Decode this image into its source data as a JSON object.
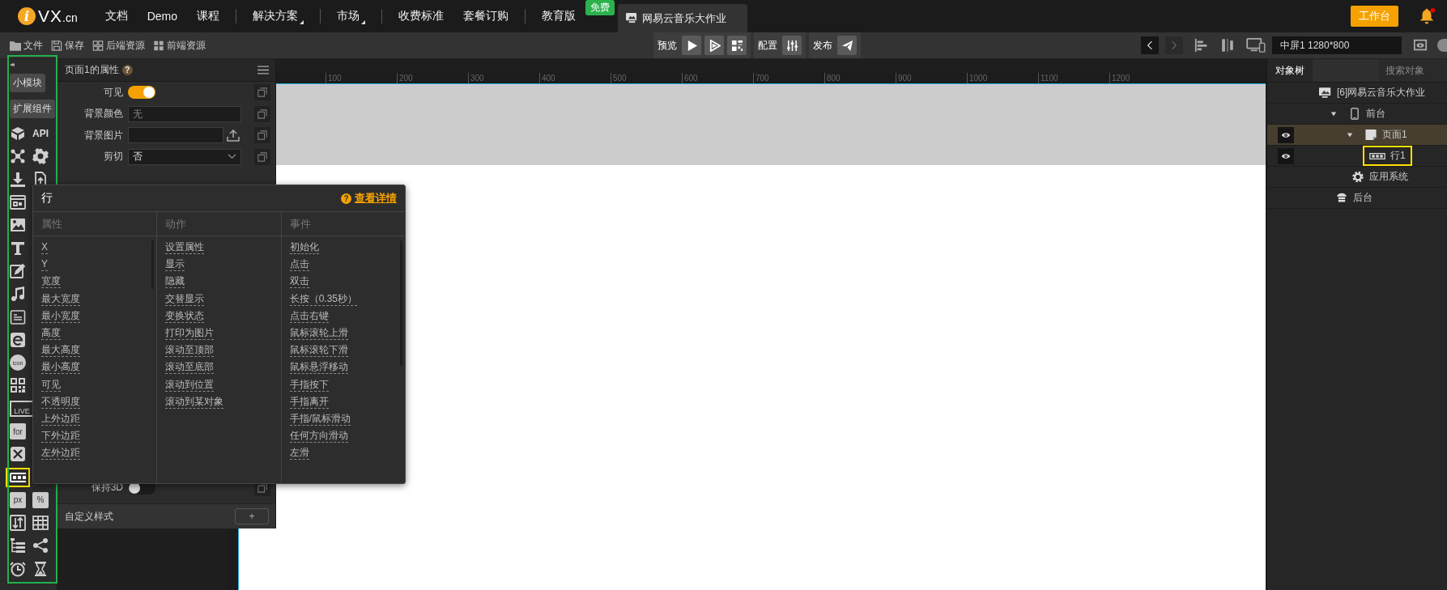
{
  "logo": {
    "mark": "i",
    "text": "VX",
    "suffix": ".cn"
  },
  "nav": [
    {
      "label": "文档",
      "divider_before": false,
      "dropdown": false
    },
    {
      "label": "Demo",
      "divider_before": false,
      "dropdown": false
    },
    {
      "label": "课程",
      "divider_before": false,
      "dropdown": false
    },
    {
      "label": "解决方案",
      "divider_before": true,
      "dropdown": true
    },
    {
      "label": "市场",
      "divider_before": true,
      "dropdown": true
    },
    {
      "label": "收费标准",
      "divider_before": true,
      "dropdown": false
    },
    {
      "label": "套餐订购",
      "divider_before": false,
      "dropdown": false
    },
    {
      "label": "教育版",
      "divider_before": true,
      "dropdown": false,
      "badge": "免费"
    }
  ],
  "project_tab": {
    "label": "网易云音乐大作业"
  },
  "workbench_button": "工作台",
  "notifications": {
    "unread": true
  },
  "toolbar": {
    "file_actions": [
      "文件",
      "保存",
      "后端资源",
      "前端资源"
    ],
    "groups": [
      {
        "label": "预览"
      },
      {
        "label": "配置"
      },
      {
        "label": "发布"
      }
    ],
    "screen": {
      "value": "中屏1 1280*800"
    }
  },
  "toolbox": {
    "collapse": "◂◂",
    "buttons": [
      "小模块",
      "扩展组件"
    ],
    "rows": [
      [
        {
          "selected": false
        },
        {
          "selected": false,
          "label": "API",
          "kind": "text"
        }
      ],
      [
        {
          "selected": false
        },
        {
          "selected": false
        }
      ],
      [
        {
          "selected": false
        },
        {
          "selected": false
        }
      ],
      [
        {
          "selected": false
        }
      ],
      [
        {
          "selected": false
        }
      ],
      [
        {
          "selected": false
        }
      ],
      [
        {
          "selected": false
        }
      ],
      [
        {
          "selected": false
        }
      ],
      [
        {
          "selected": false
        }
      ],
      [
        {
          "selected": false
        }
      ],
      [
        {
          "selected": false,
          "label": "icon",
          "kind": "circle"
        }
      ],
      [
        {
          "selected": false
        }
      ],
      [
        {
          "selected": false,
          "label": "LIVE",
          "kind": "screen"
        }
      ],
      [
        {
          "selected": false,
          "label": "for",
          "kind": "tile"
        }
      ],
      [
        {
          "selected": false
        }
      ],
      [
        {
          "selected": true
        }
      ],
      [
        {
          "selected": false,
          "label": "px",
          "kind": "tile"
        },
        {
          "selected": false,
          "label": "%",
          "kind": "tile"
        }
      ],
      [
        {
          "selected": false
        },
        {
          "selected": false
        }
      ],
      [
        {
          "selected": false
        },
        {
          "selected": false
        }
      ],
      [
        {
          "selected": false
        },
        {
          "selected": false
        }
      ]
    ]
  },
  "properties": {
    "title": "页面1的属性",
    "help": "?",
    "rows": [
      {
        "kind": "toggle",
        "label": "可见",
        "on": true
      },
      {
        "kind": "text",
        "label": "背景颜色",
        "placeholder": "无"
      },
      {
        "kind": "upload",
        "label": "背景图片"
      },
      {
        "kind": "select",
        "label": "剪切",
        "value": "否"
      }
    ],
    "bottom_rows": [
      {
        "kind": "toggle",
        "label": "保持3D",
        "on": false
      }
    ],
    "custom_style": {
      "label": "自定义样式",
      "button": "+"
    }
  },
  "ruler": {
    "labels": [
      "100",
      "200",
      "300",
      "400",
      "500",
      "600",
      "700",
      "800",
      "900",
      "1000",
      "1100",
      "1200"
    ]
  },
  "popup": {
    "title": "行",
    "help": "?",
    "link": "查看详情",
    "columns": [
      {
        "heading": "属性",
        "items": [
          "X",
          "Y",
          "宽度",
          "最大宽度",
          "最小宽度",
          "高度",
          "最大高度",
          "最小高度",
          "可见",
          "不透明度",
          "上外边距",
          "下外边距",
          "左外边距"
        ]
      },
      {
        "heading": "动作",
        "items": [
          "设置属性",
          "显示",
          "隐藏",
          "交替显示",
          "变换状态",
          "打印为图片",
          "滚动至顶部",
          "滚动至底部",
          "滚动到位置",
          "滚动到某对象"
        ]
      },
      {
        "heading": "事件",
        "items": [
          "初始化",
          "点击",
          "双击",
          "长按（0.35秒）",
          "点击右键",
          "鼠标滚轮上滑",
          "鼠标滚轮下滑",
          "鼠标悬浮移动",
          "手指按下",
          "手指离开",
          "手指/鼠标滑动",
          "任何方向滑动",
          "左滑"
        ]
      }
    ]
  },
  "object_panel": {
    "tabs": [
      {
        "label": "对象树",
        "selected": true
      }
    ],
    "search": {
      "placeholder": "搜索对象"
    },
    "tree": [
      {
        "label": "[6]网易云音乐大作业",
        "kind": "project",
        "children": [
          {
            "label": "前台",
            "kind": "frontend",
            "expanded": true,
            "children": [
              {
                "label": "页面1",
                "kind": "page",
                "expanded": true,
                "selected": true,
                "eye": true,
                "children": [
                  {
                    "label": "行1",
                    "kind": "row",
                    "selected": false,
                    "eye": true,
                    "highlighted": true
                  }
                ]
              },
              {
                "label": "应用系统",
                "kind": "system"
              }
            ]
          },
          {
            "label": "后台",
            "kind": "backend"
          }
        ]
      }
    ]
  }
}
